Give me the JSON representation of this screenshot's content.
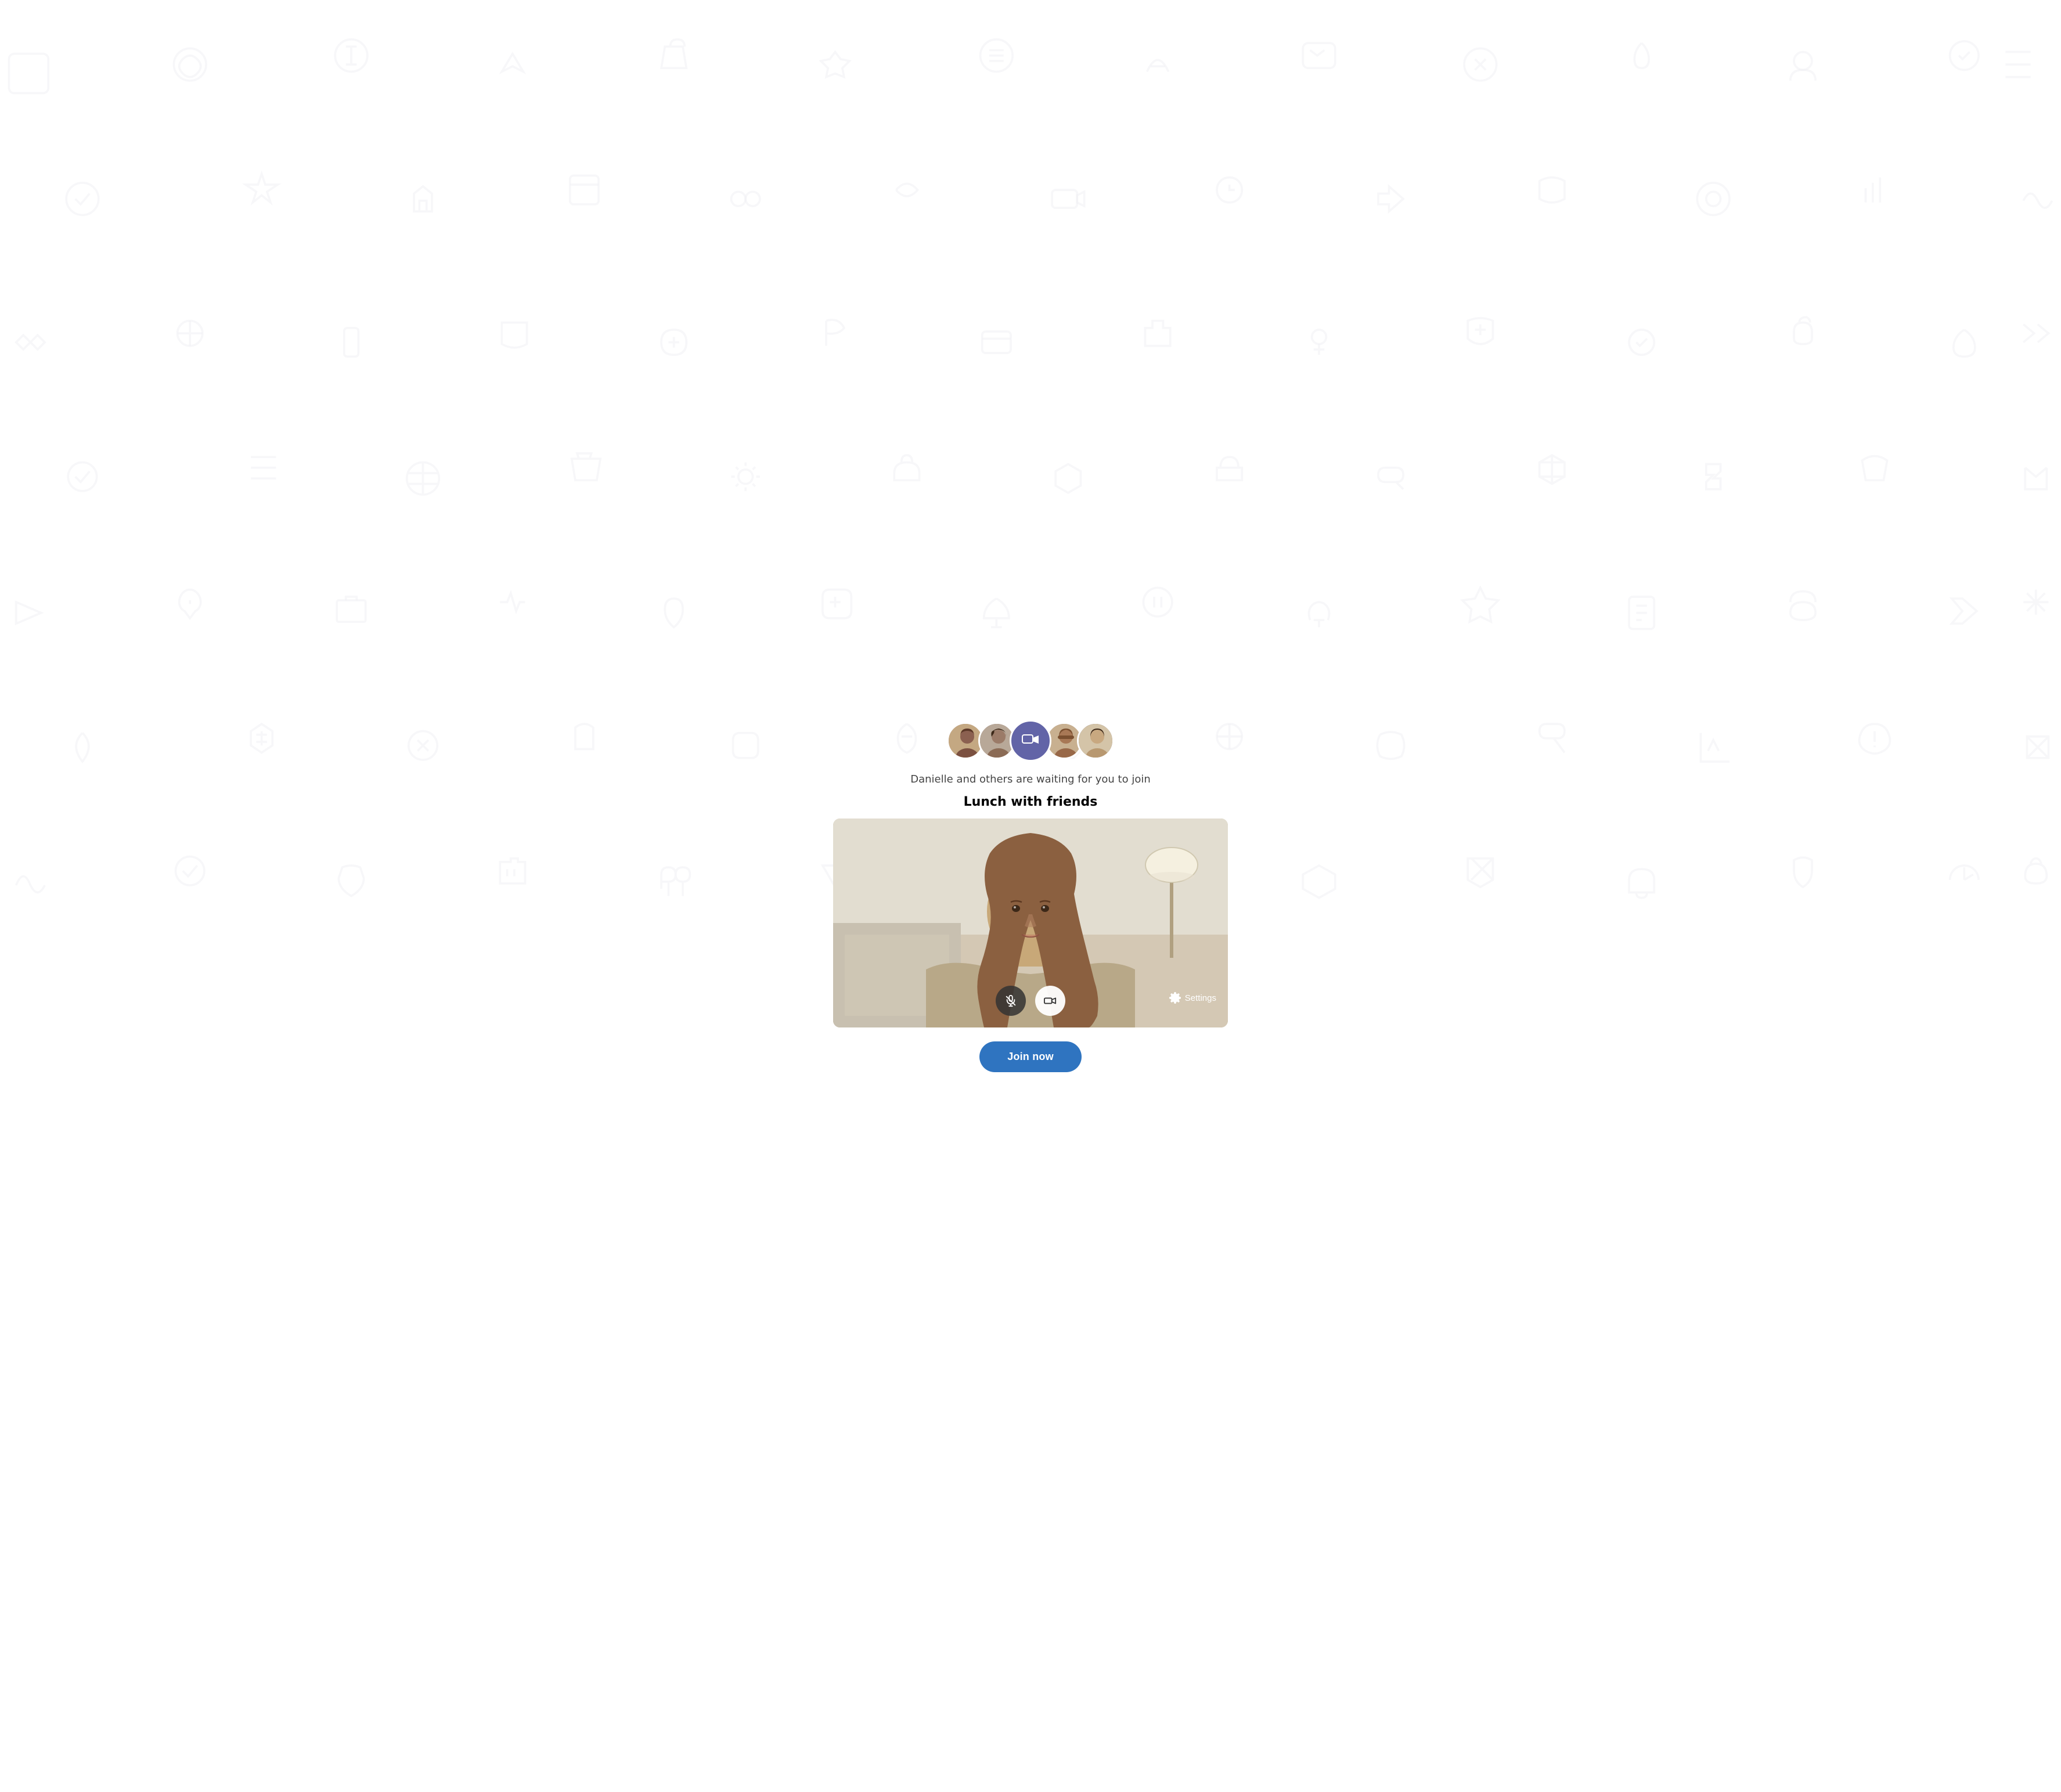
{
  "background": {
    "pattern_color": "#b0b0c0",
    "pattern_opacity": 0.12
  },
  "avatars": [
    {
      "id": "avatar-1",
      "name": "Person 1",
      "color": "#8B6F5E"
    },
    {
      "id": "avatar-2",
      "name": "Person 2",
      "color": "#5C4033"
    },
    {
      "id": "avatar-center",
      "name": "Video icon",
      "type": "video"
    },
    {
      "id": "avatar-3",
      "name": "Person 3",
      "color": "#7B5E4A"
    },
    {
      "id": "avatar-4",
      "name": "Person 4",
      "color": "#4A3728"
    }
  ],
  "subtitle": "Danielle and others are waiting for you to join",
  "meeting_title": "Lunch with friends",
  "controls": {
    "mute_label": "Mute",
    "camera_label": "Camera",
    "settings_label": "Settings"
  },
  "join_button": "Join now"
}
